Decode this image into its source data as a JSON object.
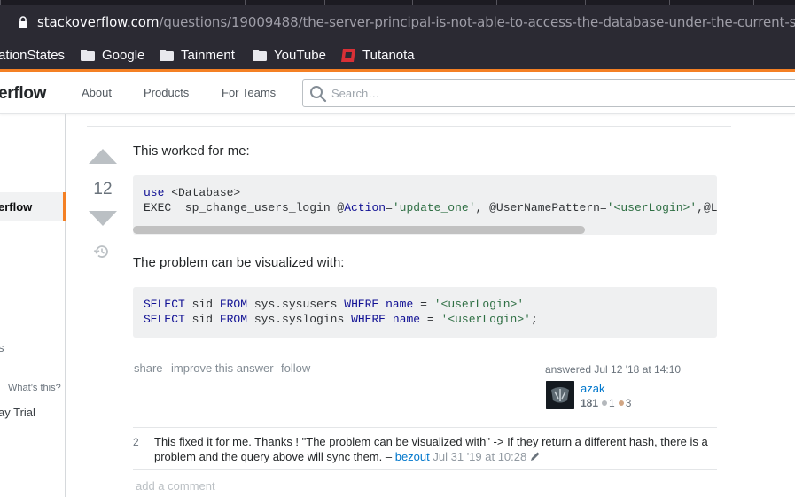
{
  "browser": {
    "url_host": "stackoverflow.com",
    "url_path": "/questions/19009488/the-server-principal-is-not-able-to-access-the-database-under-the-current-securi",
    "bookmarks": [
      {
        "label": "ationStates",
        "icon": "none"
      },
      {
        "label": "Google",
        "icon": "folder-icon"
      },
      {
        "label": "Tainment",
        "icon": "folder-icon"
      },
      {
        "label": "YouTube",
        "icon": "folder-icon"
      },
      {
        "label": "Tutanota",
        "icon": "tutanota-icon"
      }
    ]
  },
  "header": {
    "logo_text": "erflow",
    "nav": [
      "About",
      "Products",
      "For Teams"
    ],
    "search_placeholder": "Search…"
  },
  "sidebar": {
    "active_item": "erflow",
    "item_s": "s",
    "whats_this": "What’s this?",
    "trial": "ay Trial"
  },
  "answer": {
    "vote_count": "12",
    "intro": "This worked for me:",
    "code1_line1_kw": "use",
    "code1_line1_rest": " <Database>",
    "code1_line2": {
      "a": "EXEC  sp_change_users_login @",
      "b": "Action",
      "c": "=",
      "d": "'update_one'",
      "e": ", @UserNamePattern=",
      "f": "'<userLogin>'",
      "g": ",@L"
    },
    "visualize": "The problem can be visualized with:",
    "code2_line1": {
      "a": "SELECT",
      "b": " sid ",
      "c": "FROM",
      "d": " sys.sysusers ",
      "e": "WHERE",
      "f": " name ",
      "g": "=",
      "h": " ",
      "i": "'<userLogin>'"
    },
    "code2_line2": {
      "a": "SELECT",
      "b": " sid ",
      "c": "FROM",
      "d": " sys.syslogins ",
      "e": "WHERE",
      "f": " name ",
      "g": "=",
      "h": " ",
      "i": "'<userLogin>'",
      "j": ";"
    },
    "menu": [
      "share",
      "improve this answer",
      "follow"
    ],
    "answered": "answered Jul 12 '18 at 14:10",
    "user_name": "azak",
    "reputation": "181",
    "silver": "1",
    "bronze": "3",
    "colors": {
      "silver": "#b4b8bc",
      "bronze": "#d1a684",
      "accent": "#f48024",
      "link": "#0077cc"
    }
  },
  "comment": {
    "score": "2",
    "text": "This fixed it for me. Thanks ! \"The problem can be visualized with\" -> If they return a different hash, there is a problem and the query above will sync them. –",
    "user": "bezout",
    "date": "Jul 31 '19 at 10:28",
    "add_comment": "add a comment"
  }
}
